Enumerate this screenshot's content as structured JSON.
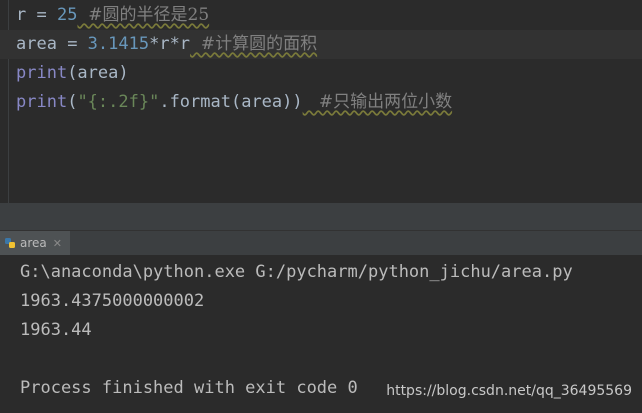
{
  "editor": {
    "lines": [
      {
        "var": "r",
        "op": " = ",
        "num": "25",
        "comment": "  #圆的半径是25"
      },
      {
        "var": "area",
        "op": " = ",
        "num": "3.1415",
        "rest": "*r*r",
        "comment": "  #计算圆的面积"
      },
      {
        "builtin": "print",
        "rest": "(area)"
      },
      {
        "builtin": "print",
        "open": "(",
        "str": "\"{:.2f}\"",
        "rest": ".format(area))",
        "comment": "   #只输出两位小数"
      }
    ]
  },
  "run_panel": {
    "tab_label": "area",
    "tab_icon": "python-icon",
    "close_icon": "close-icon"
  },
  "console": {
    "lines": [
      "G:\\anaconda\\python.exe G:/pycharm/python_jichu/area.py",
      "1963.4375000000002",
      "1963.44",
      "",
      "Process finished with exit code 0"
    ]
  },
  "watermark": "https://blog.csdn.net/qq_36495569",
  "colors": {
    "background": "#2b2b2b",
    "number": "#6897bb",
    "string": "#6a8759",
    "builtin": "#8888c6",
    "comment": "#808080",
    "text": "#a9b7c6"
  }
}
